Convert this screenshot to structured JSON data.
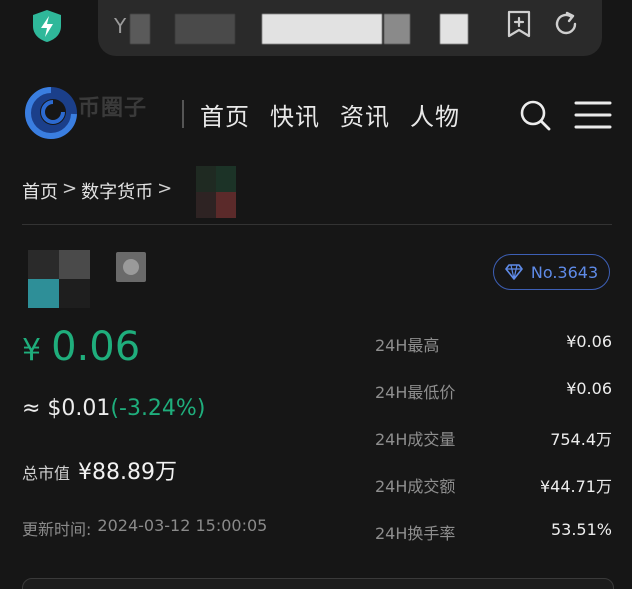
{
  "browser": {
    "url_prefix": "Y",
    "shield_icon": "shield-bolt-icon",
    "bookmark_icon": "add-bookmark-icon",
    "reload_icon": "reload-icon"
  },
  "header": {
    "logo_text": "币圈子",
    "nav": [
      {
        "label": "首页"
      },
      {
        "label": "快讯"
      },
      {
        "label": "资讯"
      },
      {
        "label": "人物"
      }
    ],
    "search_icon": "search-icon",
    "menu_icon": "menu-icon"
  },
  "breadcrumb": {
    "items": [
      "首页",
      "数字货币"
    ],
    "separator": ">"
  },
  "coin": {
    "rank": "No.3643",
    "price_currency": "¥",
    "price": "0.06",
    "usd_price": "≈ $0.01",
    "change": "(-3.24%)",
    "market_cap_label": "总市值",
    "market_cap": "¥88.89万",
    "updated_label": "更新时间:",
    "updated_time": "2024-03-12 15:00:05"
  },
  "stats": [
    {
      "label": "24H最高",
      "value": "¥0.06"
    },
    {
      "label": "24H最低价",
      "value": "¥0.06"
    },
    {
      "label": "24H成交量",
      "value": "754.4万"
    },
    {
      "label": "24H成交额",
      "value": "¥44.71万"
    },
    {
      "label": "24H换手率",
      "value": "53.51%"
    }
  ],
  "colors": {
    "background": "#161616",
    "positive_green": "#1fae7c",
    "rank_blue": "#5f8be8"
  }
}
